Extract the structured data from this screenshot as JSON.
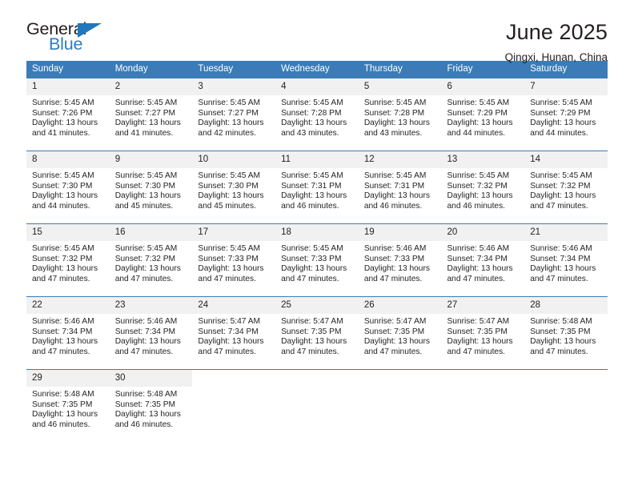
{
  "brand": {
    "name_top": "General",
    "name_bottom": "Blue",
    "triangle_icon": "triangle-icon",
    "accent_color": "#2277bd"
  },
  "header": {
    "title": "June 2025",
    "location": "Qingxi, Hunan, China"
  },
  "calendar": {
    "header_color": "#3b7cb8",
    "daynum_band_color": "#f1f1f1",
    "weekday_headers": [
      "Sunday",
      "Monday",
      "Tuesday",
      "Wednesday",
      "Thursday",
      "Friday",
      "Saturday"
    ],
    "weeks": [
      [
        {
          "day": "1",
          "info": "Sunrise: 5:45 AM\nSunset: 7:26 PM\nDaylight: 13 hours and 41 minutes."
        },
        {
          "day": "2",
          "info": "Sunrise: 5:45 AM\nSunset: 7:27 PM\nDaylight: 13 hours and 41 minutes."
        },
        {
          "day": "3",
          "info": "Sunrise: 5:45 AM\nSunset: 7:27 PM\nDaylight: 13 hours and 42 minutes."
        },
        {
          "day": "4",
          "info": "Sunrise: 5:45 AM\nSunset: 7:28 PM\nDaylight: 13 hours and 43 minutes."
        },
        {
          "day": "5",
          "info": "Sunrise: 5:45 AM\nSunset: 7:28 PM\nDaylight: 13 hours and 43 minutes."
        },
        {
          "day": "6",
          "info": "Sunrise: 5:45 AM\nSunset: 7:29 PM\nDaylight: 13 hours and 44 minutes."
        },
        {
          "day": "7",
          "info": "Sunrise: 5:45 AM\nSunset: 7:29 PM\nDaylight: 13 hours and 44 minutes."
        }
      ],
      [
        {
          "day": "8",
          "info": "Sunrise: 5:45 AM\nSunset: 7:30 PM\nDaylight: 13 hours and 44 minutes."
        },
        {
          "day": "9",
          "info": "Sunrise: 5:45 AM\nSunset: 7:30 PM\nDaylight: 13 hours and 45 minutes."
        },
        {
          "day": "10",
          "info": "Sunrise: 5:45 AM\nSunset: 7:30 PM\nDaylight: 13 hours and 45 minutes."
        },
        {
          "day": "11",
          "info": "Sunrise: 5:45 AM\nSunset: 7:31 PM\nDaylight: 13 hours and 46 minutes."
        },
        {
          "day": "12",
          "info": "Sunrise: 5:45 AM\nSunset: 7:31 PM\nDaylight: 13 hours and 46 minutes."
        },
        {
          "day": "13",
          "info": "Sunrise: 5:45 AM\nSunset: 7:32 PM\nDaylight: 13 hours and 46 minutes."
        },
        {
          "day": "14",
          "info": "Sunrise: 5:45 AM\nSunset: 7:32 PM\nDaylight: 13 hours and 47 minutes."
        }
      ],
      [
        {
          "day": "15",
          "info": "Sunrise: 5:45 AM\nSunset: 7:32 PM\nDaylight: 13 hours and 47 minutes."
        },
        {
          "day": "16",
          "info": "Sunrise: 5:45 AM\nSunset: 7:32 PM\nDaylight: 13 hours and 47 minutes."
        },
        {
          "day": "17",
          "info": "Sunrise: 5:45 AM\nSunset: 7:33 PM\nDaylight: 13 hours and 47 minutes."
        },
        {
          "day": "18",
          "info": "Sunrise: 5:45 AM\nSunset: 7:33 PM\nDaylight: 13 hours and 47 minutes."
        },
        {
          "day": "19",
          "info": "Sunrise: 5:46 AM\nSunset: 7:33 PM\nDaylight: 13 hours and 47 minutes."
        },
        {
          "day": "20",
          "info": "Sunrise: 5:46 AM\nSunset: 7:34 PM\nDaylight: 13 hours and 47 minutes."
        },
        {
          "day": "21",
          "info": "Sunrise: 5:46 AM\nSunset: 7:34 PM\nDaylight: 13 hours and 47 minutes."
        }
      ],
      [
        {
          "day": "22",
          "info": "Sunrise: 5:46 AM\nSunset: 7:34 PM\nDaylight: 13 hours and 47 minutes."
        },
        {
          "day": "23",
          "info": "Sunrise: 5:46 AM\nSunset: 7:34 PM\nDaylight: 13 hours and 47 minutes."
        },
        {
          "day": "24",
          "info": "Sunrise: 5:47 AM\nSunset: 7:34 PM\nDaylight: 13 hours and 47 minutes."
        },
        {
          "day": "25",
          "info": "Sunrise: 5:47 AM\nSunset: 7:35 PM\nDaylight: 13 hours and 47 minutes."
        },
        {
          "day": "26",
          "info": "Sunrise: 5:47 AM\nSunset: 7:35 PM\nDaylight: 13 hours and 47 minutes."
        },
        {
          "day": "27",
          "info": "Sunrise: 5:47 AM\nSunset: 7:35 PM\nDaylight: 13 hours and 47 minutes."
        },
        {
          "day": "28",
          "info": "Sunrise: 5:48 AM\nSunset: 7:35 PM\nDaylight: 13 hours and 47 minutes."
        }
      ],
      [
        {
          "day": "29",
          "info": "Sunrise: 5:48 AM\nSunset: 7:35 PM\nDaylight: 13 hours and 46 minutes."
        },
        {
          "day": "30",
          "info": "Sunrise: 5:48 AM\nSunset: 7:35 PM\nDaylight: 13 hours and 46 minutes."
        },
        {
          "day": "",
          "info": ""
        },
        {
          "day": "",
          "info": ""
        },
        {
          "day": "",
          "info": ""
        },
        {
          "day": "",
          "info": ""
        },
        {
          "day": "",
          "info": ""
        }
      ]
    ]
  }
}
